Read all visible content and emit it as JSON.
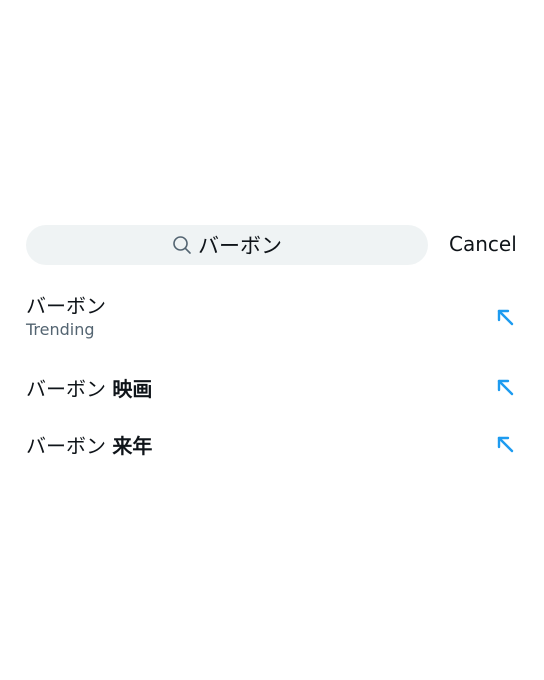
{
  "search": {
    "query": "バーボン",
    "cancel_label": "Cancel",
    "icon": "search-icon"
  },
  "suggestions": [
    {
      "base": "バーボン",
      "extra": "",
      "subtitle": "Trending"
    },
    {
      "base": "バーボン",
      "extra": "映画",
      "subtitle": ""
    },
    {
      "base": "バーボン",
      "extra": "来年",
      "subtitle": ""
    }
  ],
  "colors": {
    "accent": "#1d9bf0",
    "search_bg": "#eff3f4",
    "secondary_text": "#536471"
  }
}
